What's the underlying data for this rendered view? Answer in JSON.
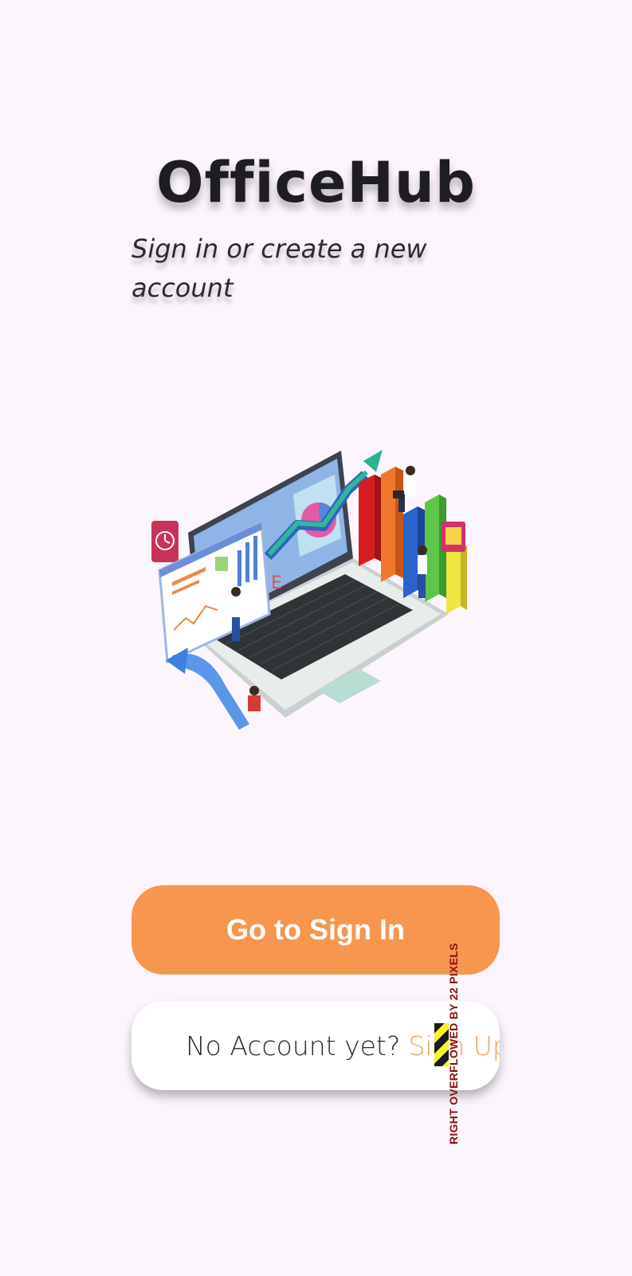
{
  "app": {
    "title": "OfficeHub",
    "subtitle": "Sign in or create a new account"
  },
  "actions": {
    "sign_in_label": "Go to Sign In",
    "no_account_prompt": "No Account yet?",
    "sign_up_link": "Sign Up"
  },
  "debug": {
    "overflow_warning": "RIGHT OVERFLOWED BY 22 PIXELS"
  },
  "colors": {
    "background": "#fdf5fd",
    "accent": "#f7964f",
    "link": "#f2a15e",
    "title": "#1e1d22"
  },
  "illustration": {
    "icon": "analytics-laptop-illustration"
  }
}
